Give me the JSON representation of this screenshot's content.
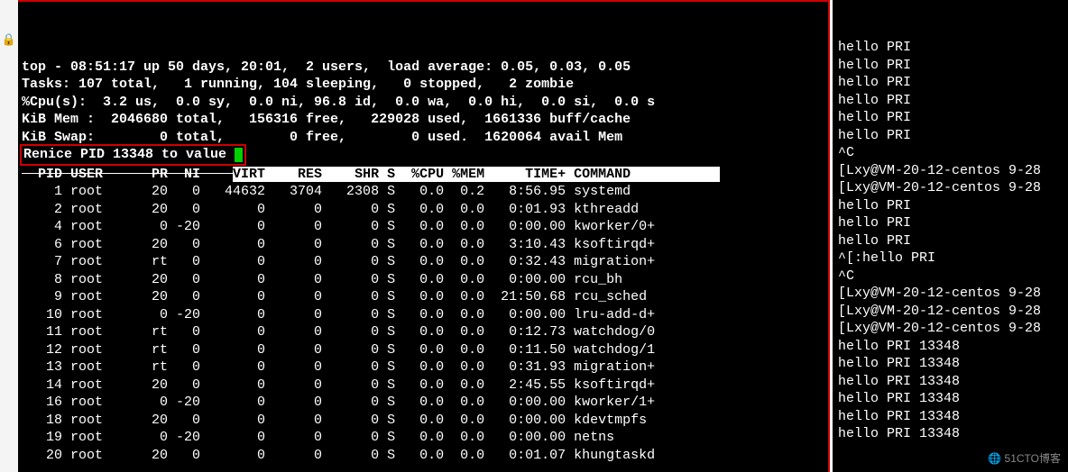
{
  "side_char": "🔒",
  "top_summary": {
    "line1": "top - 08:51:17 up 50 days, 20:01,  2 users,  load average: 0.05, 0.03, 0.05",
    "line2": "Tasks: 107 total,   1 running, 104 sleeping,   0 stopped,   2 zombie",
    "line3": "%Cpu(s):  3.2 us,  0.0 sy,  0.0 ni, 96.8 id,  0.0 wa,  0.0 hi,  0.0 si,  0.0 s",
    "line4": "KiB Mem :  2046680 total,   156316 free,   229028 used,  1661336 buff/cache",
    "line5": "KiB Swap:        0 total,        0 free,        0 used.  1620064 avail Mem"
  },
  "renice_prompt": "Renice PID 13348 to value ",
  "header_struck": "  PID USER      PR  NI    ",
  "header_white": "VIRT    RES    SHR S  %CPU %MEM     TIME+ COMMAND           ",
  "processes": [
    {
      "pid": "    1",
      "user": "root",
      "pr": "20",
      "ni": "  0",
      "virt": "  44632",
      "res": "  3704",
      "shr": "  2308",
      "s": "S",
      "cpu": " 0.0",
      "mem": " 0.2",
      "time": "  8:56.95",
      "cmd": "systemd"
    },
    {
      "pid": "    2",
      "user": "root",
      "pr": "20",
      "ni": "  0",
      "virt": "      0",
      "res": "     0",
      "shr": "     0",
      "s": "S",
      "cpu": " 0.0",
      "mem": " 0.0",
      "time": "  0:01.93",
      "cmd": "kthreadd"
    },
    {
      "pid": "    4",
      "user": "root",
      "pr": " 0",
      "ni": "-20",
      "virt": "      0",
      "res": "     0",
      "shr": "     0",
      "s": "S",
      "cpu": " 0.0",
      "mem": " 0.0",
      "time": "  0:00.00",
      "cmd": "kworker/0+"
    },
    {
      "pid": "    6",
      "user": "root",
      "pr": "20",
      "ni": "  0",
      "virt": "      0",
      "res": "     0",
      "shr": "     0",
      "s": "S",
      "cpu": " 0.0",
      "mem": " 0.0",
      "time": "  3:10.43",
      "cmd": "ksoftirqd+"
    },
    {
      "pid": "    7",
      "user": "root",
      "pr": "rt",
      "ni": "  0",
      "virt": "      0",
      "res": "     0",
      "shr": "     0",
      "s": "S",
      "cpu": " 0.0",
      "mem": " 0.0",
      "time": "  0:32.43",
      "cmd": "migration+"
    },
    {
      "pid": "    8",
      "user": "root",
      "pr": "20",
      "ni": "  0",
      "virt": "      0",
      "res": "     0",
      "shr": "     0",
      "s": "S",
      "cpu": " 0.0",
      "mem": " 0.0",
      "time": "  0:00.00",
      "cmd": "rcu_bh"
    },
    {
      "pid": "    9",
      "user": "root",
      "pr": "20",
      "ni": "  0",
      "virt": "      0",
      "res": "     0",
      "shr": "     0",
      "s": "S",
      "cpu": " 0.0",
      "mem": " 0.0",
      "time": " 21:50.68",
      "cmd": "rcu_sched"
    },
    {
      "pid": "   10",
      "user": "root",
      "pr": " 0",
      "ni": "-20",
      "virt": "      0",
      "res": "     0",
      "shr": "     0",
      "s": "S",
      "cpu": " 0.0",
      "mem": " 0.0",
      "time": "  0:00.00",
      "cmd": "lru-add-d+"
    },
    {
      "pid": "   11",
      "user": "root",
      "pr": "rt",
      "ni": "  0",
      "virt": "      0",
      "res": "     0",
      "shr": "     0",
      "s": "S",
      "cpu": " 0.0",
      "mem": " 0.0",
      "time": "  0:12.73",
      "cmd": "watchdog/0"
    },
    {
      "pid": "   12",
      "user": "root",
      "pr": "rt",
      "ni": "  0",
      "virt": "      0",
      "res": "     0",
      "shr": "     0",
      "s": "S",
      "cpu": " 0.0",
      "mem": " 0.0",
      "time": "  0:11.50",
      "cmd": "watchdog/1"
    },
    {
      "pid": "   13",
      "user": "root",
      "pr": "rt",
      "ni": "  0",
      "virt": "      0",
      "res": "     0",
      "shr": "     0",
      "s": "S",
      "cpu": " 0.0",
      "mem": " 0.0",
      "time": "  0:31.93",
      "cmd": "migration+"
    },
    {
      "pid": "   14",
      "user": "root",
      "pr": "20",
      "ni": "  0",
      "virt": "      0",
      "res": "     0",
      "shr": "     0",
      "s": "S",
      "cpu": " 0.0",
      "mem": " 0.0",
      "time": "  2:45.55",
      "cmd": "ksoftirqd+"
    },
    {
      "pid": "   16",
      "user": "root",
      "pr": " 0",
      "ni": "-20",
      "virt": "      0",
      "res": "     0",
      "shr": "     0",
      "s": "S",
      "cpu": " 0.0",
      "mem": " 0.0",
      "time": "  0:00.00",
      "cmd": "kworker/1+"
    },
    {
      "pid": "   18",
      "user": "root",
      "pr": "20",
      "ni": "  0",
      "virt": "      0",
      "res": "     0",
      "shr": "     0",
      "s": "S",
      "cpu": " 0.0",
      "mem": " 0.0",
      "time": "  0:00.00",
      "cmd": "kdevtmpfs"
    },
    {
      "pid": "   19",
      "user": "root",
      "pr": " 0",
      "ni": "-20",
      "virt": "      0",
      "res": "     0",
      "shr": "     0",
      "s": "S",
      "cpu": " 0.0",
      "mem": " 0.0",
      "time": "  0:00.00",
      "cmd": "netns"
    },
    {
      "pid": "   20",
      "user": "root",
      "pr": "20",
      "ni": "  0",
      "virt": "      0",
      "res": "     0",
      "shr": "     0",
      "s": "S",
      "cpu": " 0.0",
      "mem": " 0.0",
      "time": "  0:01.07",
      "cmd": "khungtaskd"
    }
  ],
  "right_lines": [
    "hello PRI",
    "hello PRI",
    "hello PRI",
    "hello PRI",
    "hello PRI",
    "hello PRI",
    "^C",
    "[Lxy@VM-20-12-centos 9-28",
    "[Lxy@VM-20-12-centos 9-28",
    "hello PRI",
    "hello PRI",
    "hello PRI",
    "^[:hello PRI",
    "^C",
    "[Lxy@VM-20-12-centos 9-28",
    "[Lxy@VM-20-12-centos 9-28",
    "[Lxy@VM-20-12-centos 9-28",
    "hello PRI 13348",
    "hello PRI 13348",
    "hello PRI 13348",
    "hello PRI 13348",
    "hello PRI 13348",
    "hello PRI 13348"
  ],
  "watermark": "🌐 51CTO博客"
}
